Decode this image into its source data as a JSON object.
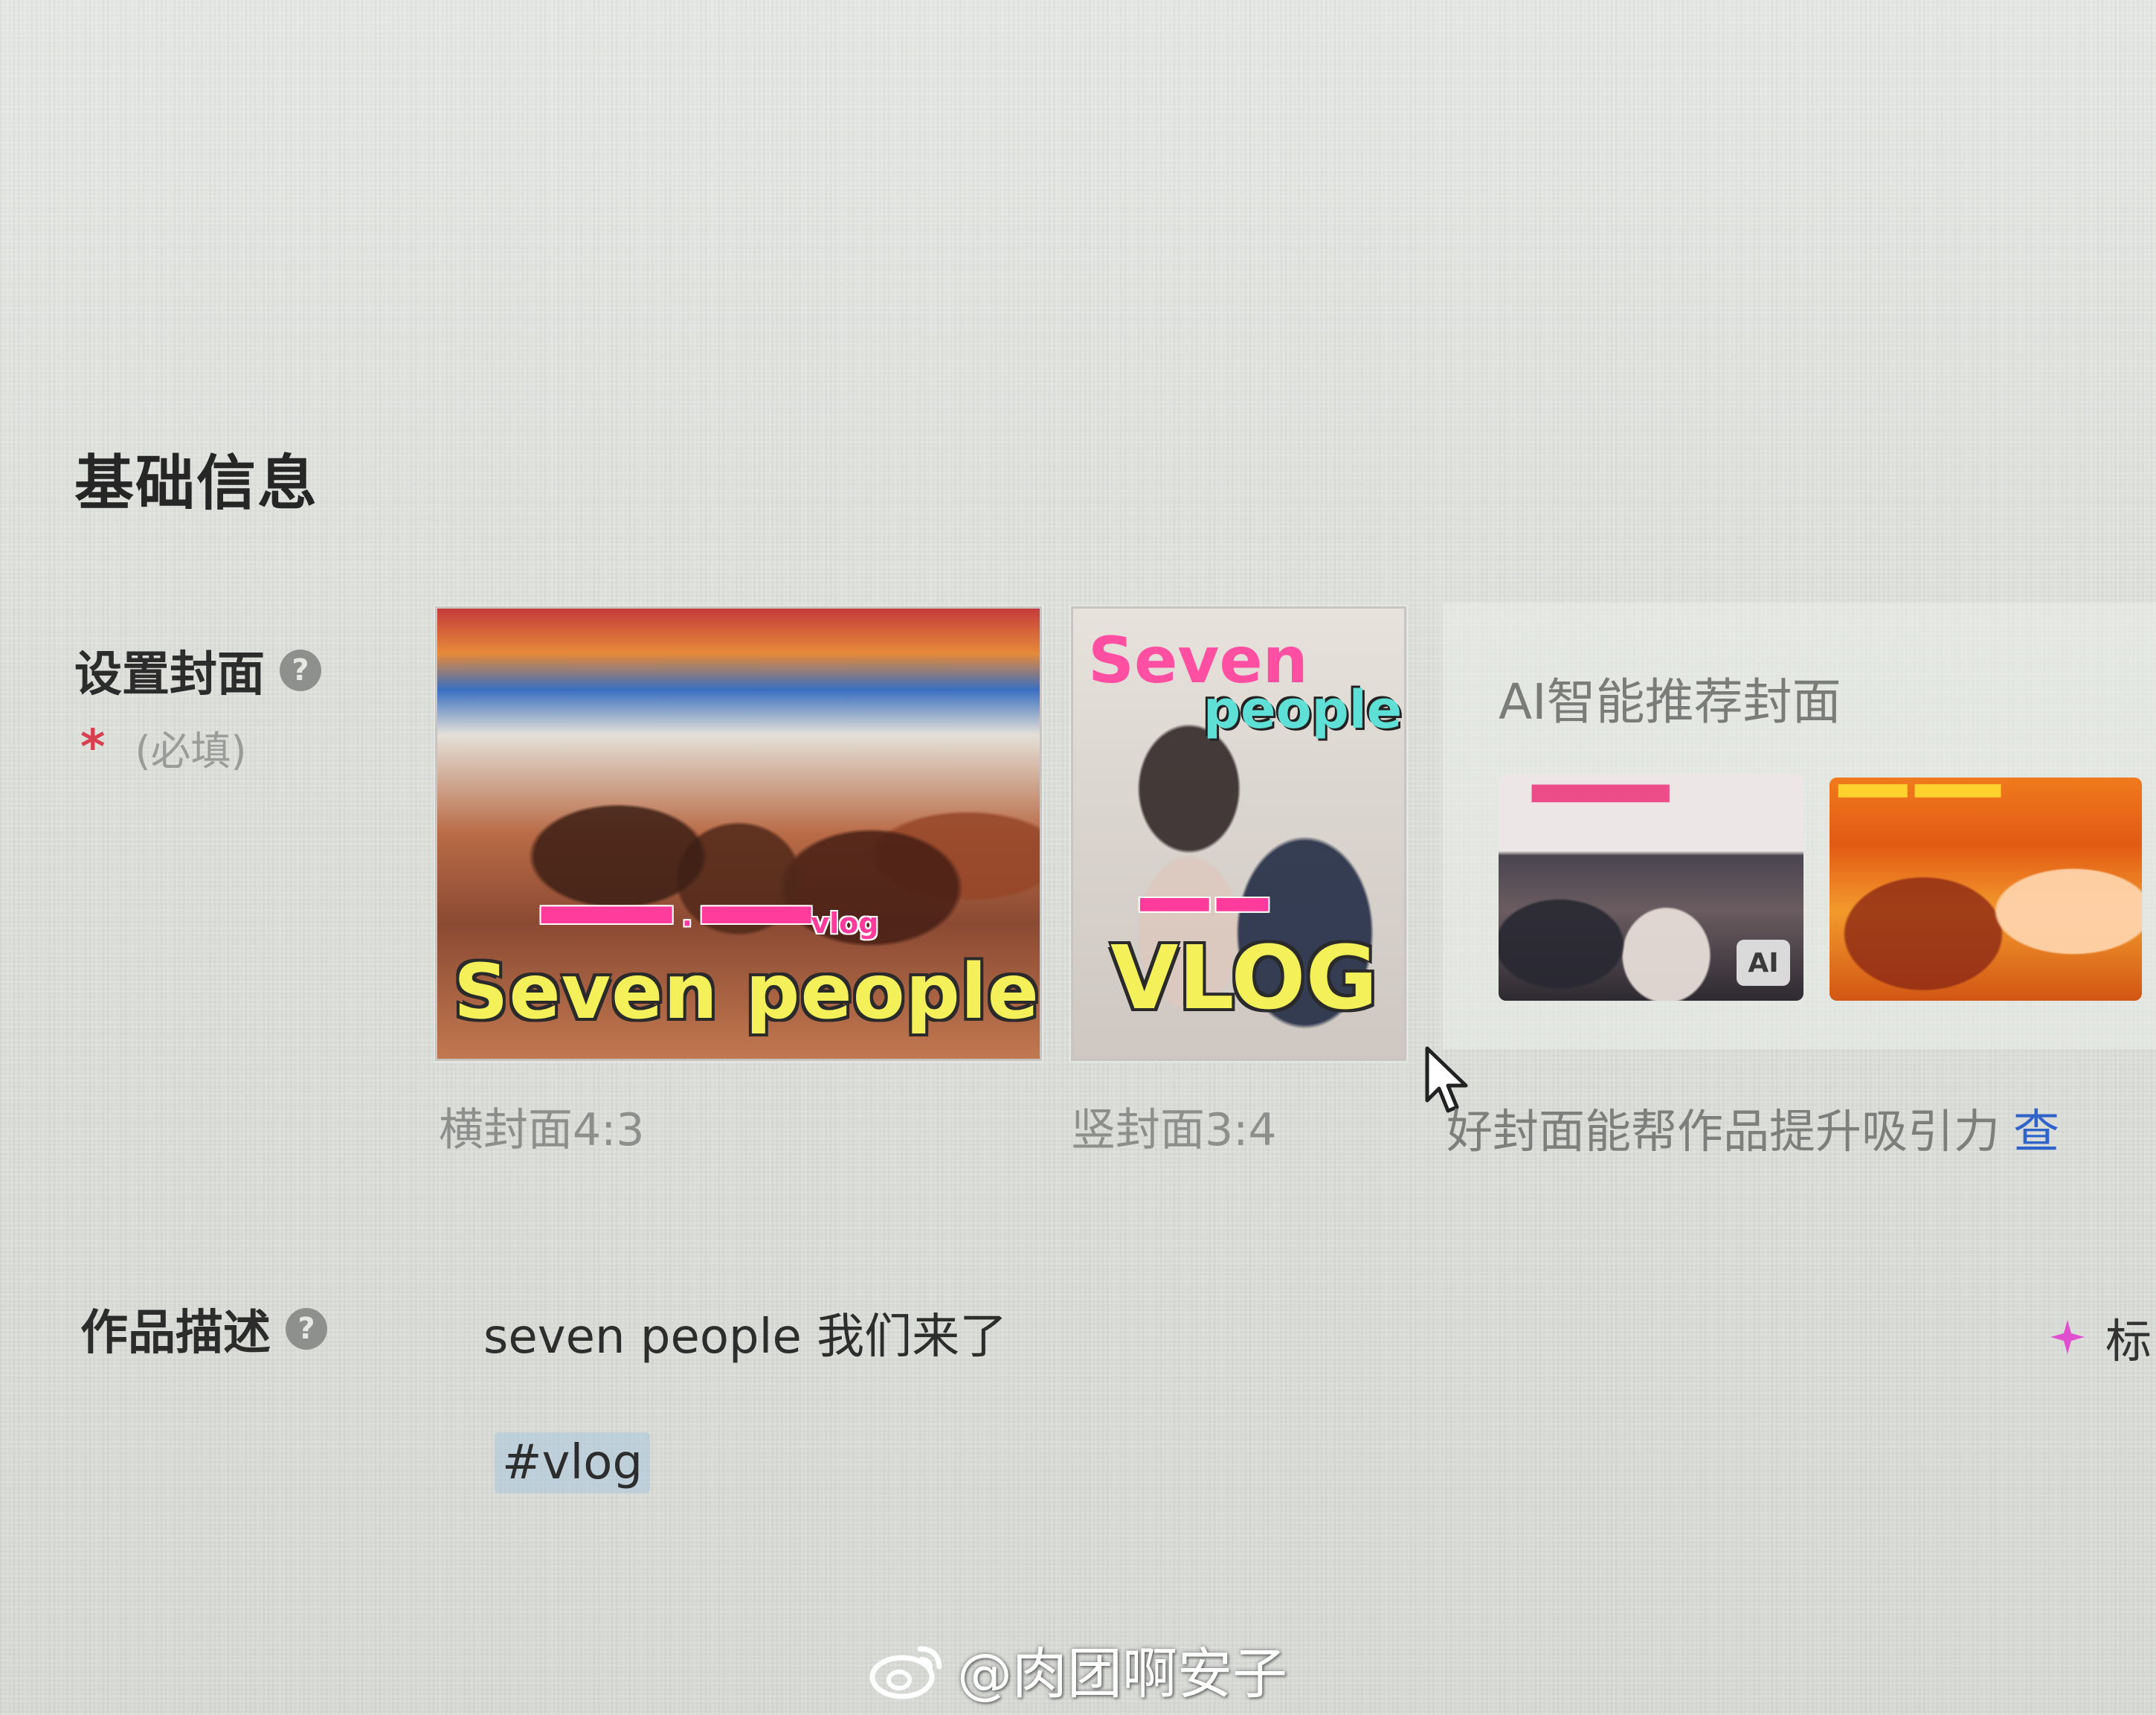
{
  "section": {
    "title": "基础信息"
  },
  "cover": {
    "label": "设置封面",
    "help_icon": "?",
    "required_star": "*",
    "required_text": "(必填)",
    "horizontal": {
      "caption": "横封面4:3",
      "title_text": "Seven people"
    },
    "vertical": {
      "caption": "竖封面3:4",
      "top_text_1": "Seven",
      "top_text_2": "people",
      "title_text": "VLOG"
    },
    "ai": {
      "title": "AI智能推荐封面",
      "badge": "AI"
    },
    "promo_text": "好封面能帮作品提升吸引力",
    "promo_link": "查"
  },
  "description": {
    "label": "作品描述",
    "help_icon": "?",
    "text": "seven people 我们来了",
    "tag": "#vlog",
    "ai_write_label": "标"
  },
  "watermark": {
    "text": "@肉团啊安子"
  },
  "icons": {
    "help": "question-circle-icon",
    "sparkle": "sparkle-icon",
    "cursor": "mouse-pointer-icon",
    "watermark": "weibo-logo-icon"
  },
  "colors": {
    "required": "#d8404f",
    "link": "#2f63c9",
    "tag_bg": "#aac6de",
    "sparkle": "#e04fd0"
  }
}
